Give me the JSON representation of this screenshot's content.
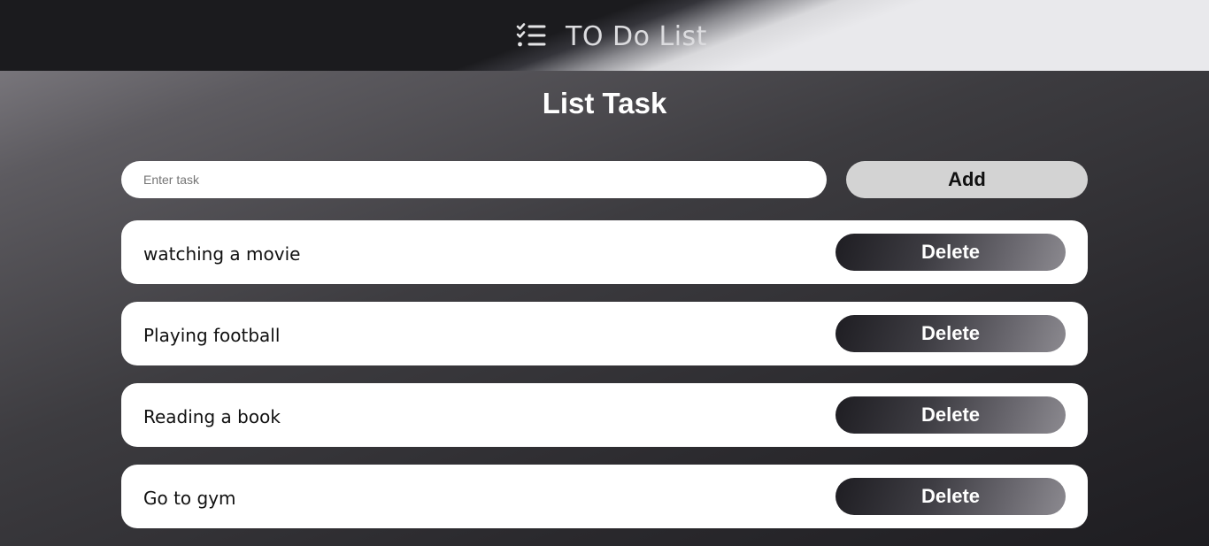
{
  "header": {
    "icon": "checklist-icon",
    "title": "TO Do List"
  },
  "main": {
    "title": "List Task",
    "input": {
      "placeholder": "Enter task",
      "value": ""
    },
    "add_label": "Add",
    "tasks": [
      {
        "text": "watching a movie",
        "delete_label": "Delete"
      },
      {
        "text": "Playing football",
        "delete_label": "Delete"
      },
      {
        "text": "Reading a book",
        "delete_label": "Delete"
      },
      {
        "text": "Go to gym",
        "delete_label": "Delete"
      }
    ]
  },
  "colors": {
    "header_dark": "#1b1b1e",
    "header_light": "#e9e9ec",
    "add_button": "#d3d3d3",
    "card": "#ffffff"
  }
}
